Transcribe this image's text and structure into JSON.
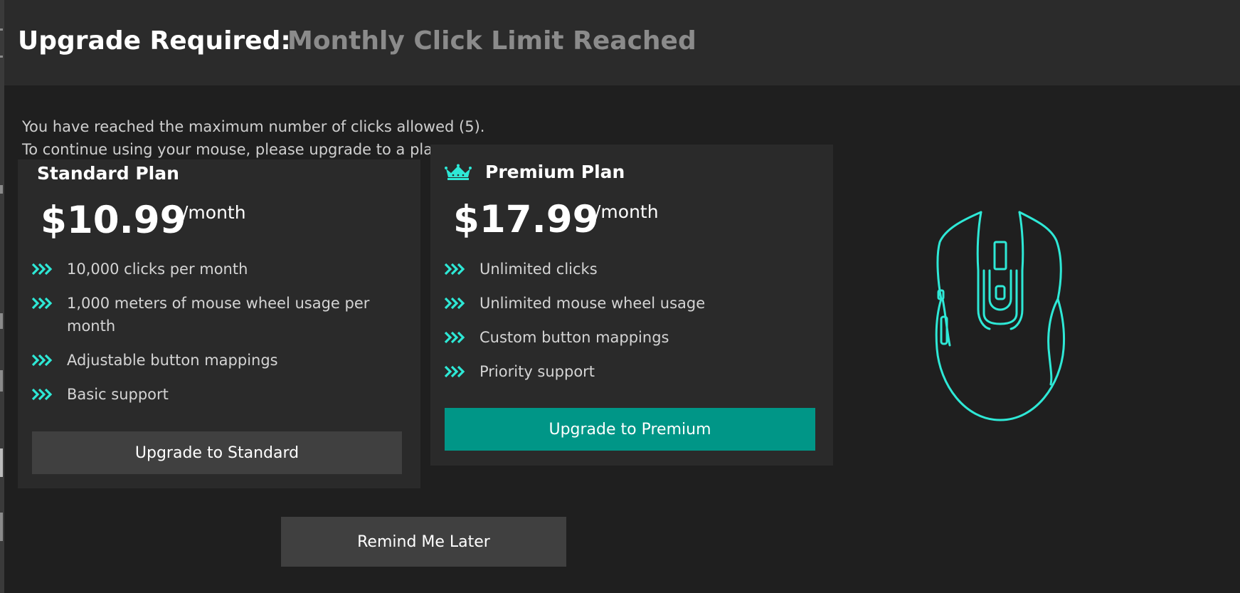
{
  "header": {
    "title": "Upgrade Required:",
    "subtitle": "Monthly Click Limit Reached"
  },
  "message": {
    "line1": "You have reached the maximum number of clicks allowed (5).",
    "line2": "To continue using your mouse, please upgrade to a plan."
  },
  "plans": {
    "standard": {
      "title": "Standard Plan",
      "price": "$10.99",
      "period": "/month",
      "features": [
        "10,000 clicks per month",
        "1,000 meters of mouse wheel usage per month",
        "Adjustable button mappings",
        "Basic support"
      ],
      "button_label": "Upgrade to Standard"
    },
    "premium": {
      "title": "Premium Plan",
      "price": "$17.99",
      "period": "/month",
      "features": [
        "Unlimited clicks",
        "Unlimited mouse wheel usage",
        "Custom button mappings",
        "Priority support"
      ],
      "button_label": "Upgrade to Premium"
    }
  },
  "footer": {
    "remind_label": "Remind Me Later"
  },
  "icons": {
    "crown": "crown-icon",
    "feature_bullet": "triple-chevron-right-icon",
    "illustration": "computer-mouse-icon"
  },
  "colors": {
    "accent": "#2ee8d6",
    "premium_button": "#009687",
    "standard_button": "#404040",
    "header_bg": "#2b2b2b",
    "card_bg": "#2a2a2a",
    "background": "#1f1f1f"
  }
}
